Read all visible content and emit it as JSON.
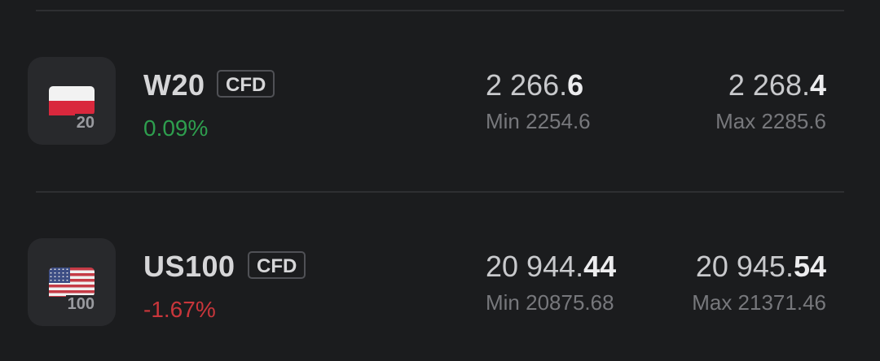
{
  "rows": [
    {
      "symbol": "W20",
      "badge": "CFD",
      "icon_number": "20",
      "flag_icon": "poland-flag-icon",
      "change": "0.09%",
      "change_color": "#2e9e4e",
      "bid_main": "2 266.",
      "bid_bold": "6",
      "min_label": "Min 2254.6",
      "ask_main": "2 268.",
      "ask_bold": "4",
      "max_label": "Max 2285.6"
    },
    {
      "symbol": "US100",
      "badge": "CFD",
      "icon_number": "100",
      "flag_icon": "usa-flag-icon",
      "change": "-1.67%",
      "change_color": "#c9363b",
      "bid_main": "20 944.",
      "bid_bold": "44",
      "min_label": "Min 20875.68",
      "ask_main": "20 945.",
      "ask_bold": "54",
      "max_label": "Max 21371.46"
    }
  ]
}
